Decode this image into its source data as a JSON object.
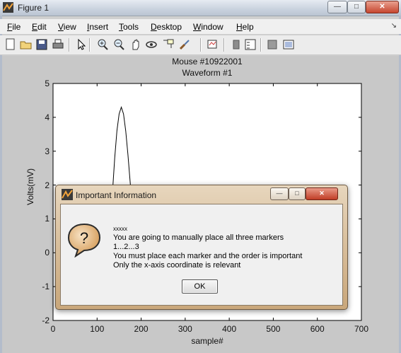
{
  "window": {
    "title": "Figure 1",
    "controls": {
      "minimize": "—",
      "maximize": "□",
      "close": "✕"
    }
  },
  "menu": [
    "File",
    "Edit",
    "View",
    "Insert",
    "Tools",
    "Desktop",
    "Window",
    "Help"
  ],
  "menu_hotkeys": [
    "F",
    "E",
    "V",
    "I",
    "T",
    "D",
    "W",
    "H"
  ],
  "toolbar_icons": [
    "new-figure-icon",
    "open-file-icon",
    "save-icon",
    "print-icon",
    "pointer-icon",
    "zoom-in-icon",
    "zoom-out-icon",
    "pan-icon",
    "rotate-3d-icon",
    "data-cursor-icon",
    "brush-icon",
    "link-plot-icon",
    "colorbar-icon",
    "legend-icon",
    "hide-plot-tools-icon",
    "show-plot-tools-icon"
  ],
  "plot": {
    "title_line1": "Mouse #10922001",
    "title_line2": "Waveform #1",
    "xlabel": "sample#",
    "ylabel": "Volts(mV)"
  },
  "chart_data": {
    "type": "line",
    "title": "Mouse #10922001 Waveform #1",
    "xlabel": "sample#",
    "ylabel": "Volts(mV)",
    "xlim": [
      0,
      700
    ],
    "ylim": [
      -2,
      5
    ],
    "xticks": [
      0,
      100,
      200,
      300,
      400,
      500,
      600,
      700
    ],
    "yticks": [
      -2,
      -1,
      0,
      1,
      2,
      3,
      4,
      5
    ],
    "series": [
      {
        "x": [
          110,
          120,
          130,
          135,
          140,
          145,
          150,
          155,
          160,
          165,
          170,
          175,
          180,
          190
        ],
        "y": [
          0,
          0.3,
          1.0,
          1.8,
          2.8,
          3.6,
          4.1,
          4.3,
          4.1,
          3.6,
          2.9,
          2.1,
          1.3,
          0
        ]
      }
    ],
    "color": "#000000",
    "grid": false
  },
  "dialog": {
    "title": "Important Information",
    "lines": [
      "xxxxx",
      "You are going to manually place all three markers",
      "1...2...3",
      "You must place each marker and the order is important",
      "Only the x-axis coordinate is relevant"
    ],
    "ok_label": "OK",
    "controls": {
      "minimize": "—",
      "maximize": "□",
      "close": "✕"
    }
  }
}
